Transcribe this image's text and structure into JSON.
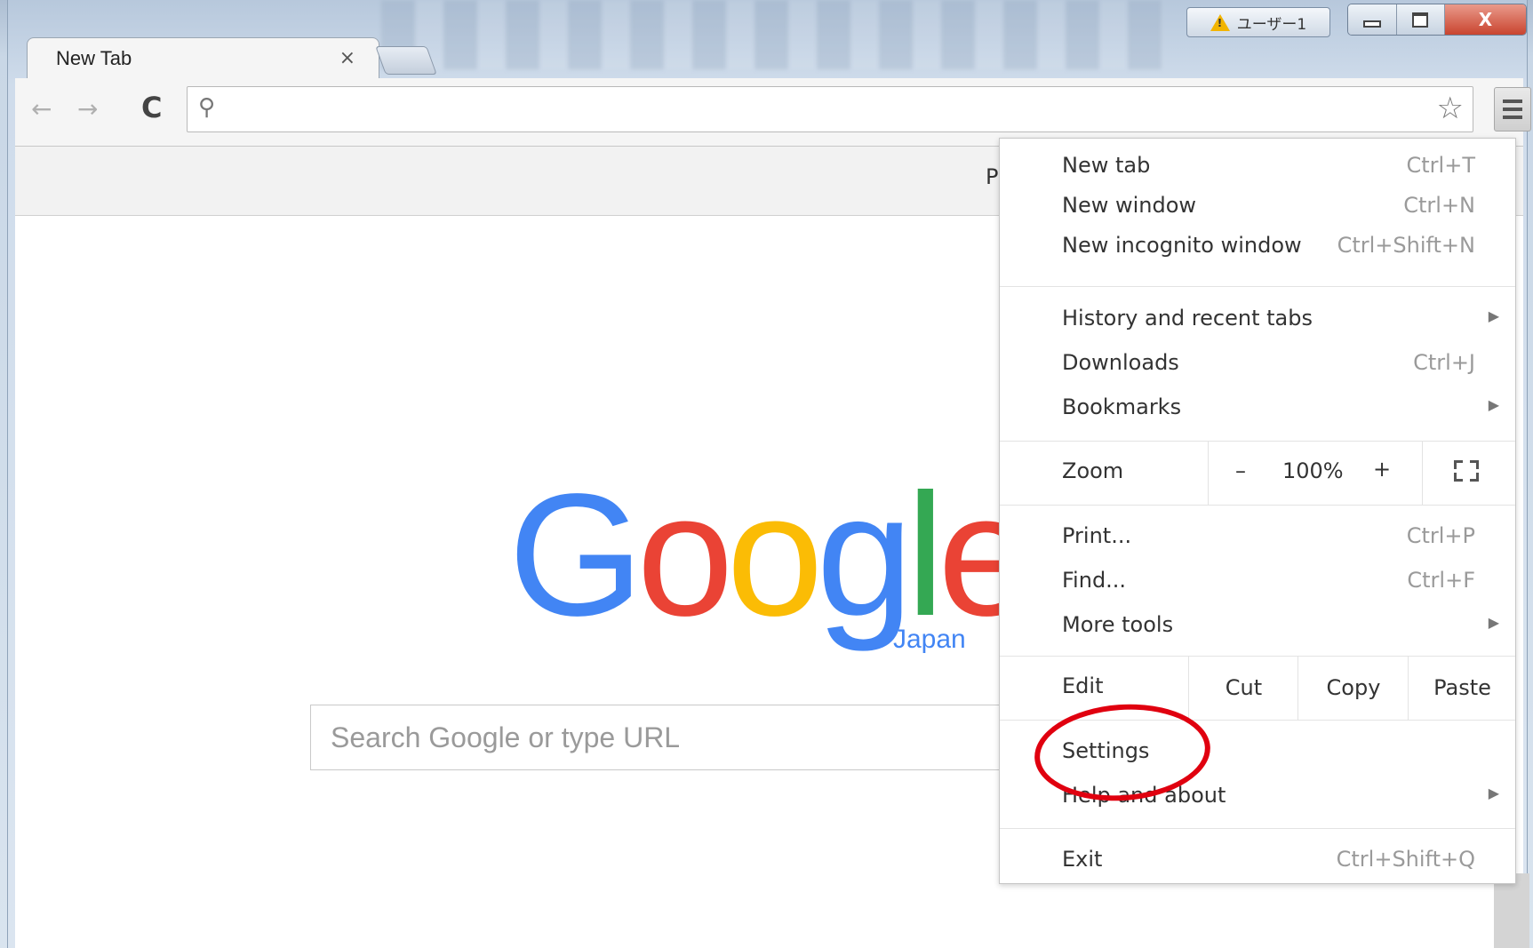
{
  "window": {
    "profile_label": "ユーザー1",
    "close_glyph": "X"
  },
  "tab": {
    "title": "New Tab",
    "close_glyph": "×"
  },
  "toolbar": {
    "back_glyph": "←",
    "forward_glyph": "→",
    "reload_glyph": "C",
    "search_glyph": "⚲",
    "star_glyph": "☆",
    "omnibox_value": ""
  },
  "bookmark_bar": {
    "partial_text": "P"
  },
  "page": {
    "logo": {
      "g1": "G",
      "o1": "o",
      "o2": "o",
      "g2": "g",
      "l": "l",
      "e": "e"
    },
    "logo_region": "Japan",
    "search_placeholder": "Search Google or type URL"
  },
  "menu": {
    "items_top": [
      {
        "label": "New tab",
        "shortcut": "Ctrl+T"
      },
      {
        "label": "New window",
        "shortcut": "Ctrl+N"
      },
      {
        "label": "New incognito window",
        "shortcut": "Ctrl+Shift+N"
      }
    ],
    "items_history": [
      {
        "label": "History and recent tabs",
        "submenu": "▶"
      },
      {
        "label": "Downloads",
        "shortcut": "Ctrl+J"
      },
      {
        "label": "Bookmarks",
        "submenu": "▶"
      }
    ],
    "zoom": {
      "label": "Zoom",
      "minus": "–",
      "value": "100%",
      "plus": "+"
    },
    "items_tools": [
      {
        "label": "Print...",
        "shortcut": "Ctrl+P"
      },
      {
        "label": "Find...",
        "shortcut": "Ctrl+F"
      },
      {
        "label": "More tools",
        "submenu": "▶"
      }
    ],
    "edit": {
      "label": "Edit",
      "cut": "Cut",
      "copy": "Copy",
      "paste": "Paste"
    },
    "settings": "Settings",
    "help": {
      "label": "Help and about",
      "submenu": "▶"
    },
    "exit": {
      "label": "Exit",
      "shortcut": "Ctrl+Shift+Q"
    }
  },
  "colors": {
    "highlight": "#e0000f",
    "google_blue": "#4285f4",
    "google_red": "#ea4335",
    "google_yellow": "#fbbc05",
    "google_green": "#34a853"
  }
}
